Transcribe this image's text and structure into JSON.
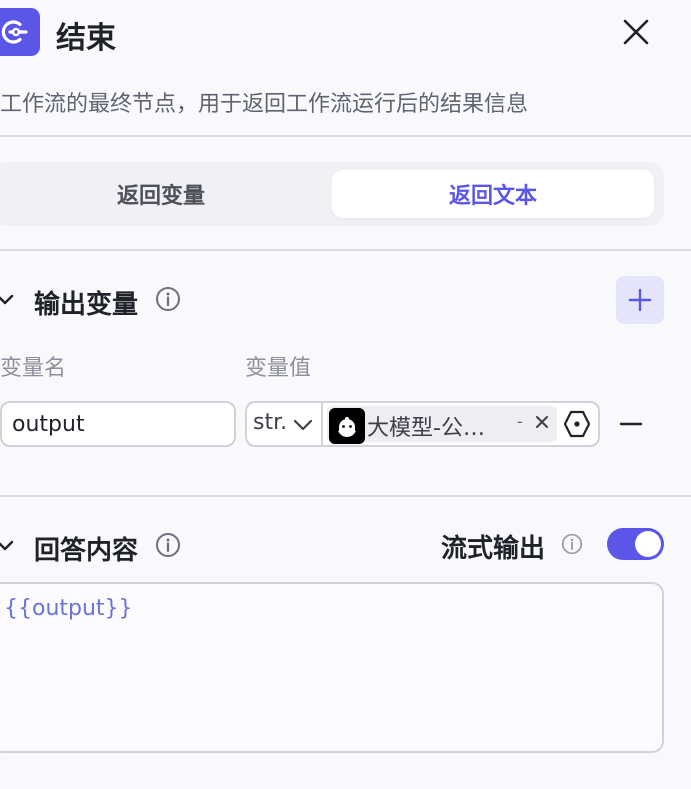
{
  "header": {
    "title": "结束",
    "description": "工作流的最终节点，用于返回工作流运行后的结果信息"
  },
  "tabs": [
    {
      "label": "返回变量",
      "active": false
    },
    {
      "label": "返回文本",
      "active": true
    }
  ],
  "output_section": {
    "title": "输出变量",
    "columns": {
      "name": "变量名",
      "value": "变量值"
    },
    "rows": [
      {
        "name": "output",
        "type": "str.",
        "reference": "大模型-公…",
        "reference_suffix": "-"
      }
    ]
  },
  "answer_section": {
    "title": "回答内容",
    "stream_label": "流式输出",
    "stream_enabled": true,
    "content": "{{output}}"
  },
  "icons": {
    "node": "end-node-icon",
    "close": "close-icon",
    "collapse": "chevron-down-icon",
    "info": "info-icon",
    "add": "plus-icon",
    "remove": "minus-icon",
    "avatar": "llm-avatar-icon",
    "variable": "variable-hexagon-icon"
  },
  "colors": {
    "accent": "#5b55e8",
    "accent_light": "#e4e4fb",
    "template_text": "#6a74d8",
    "background": "#f9f9fc"
  }
}
